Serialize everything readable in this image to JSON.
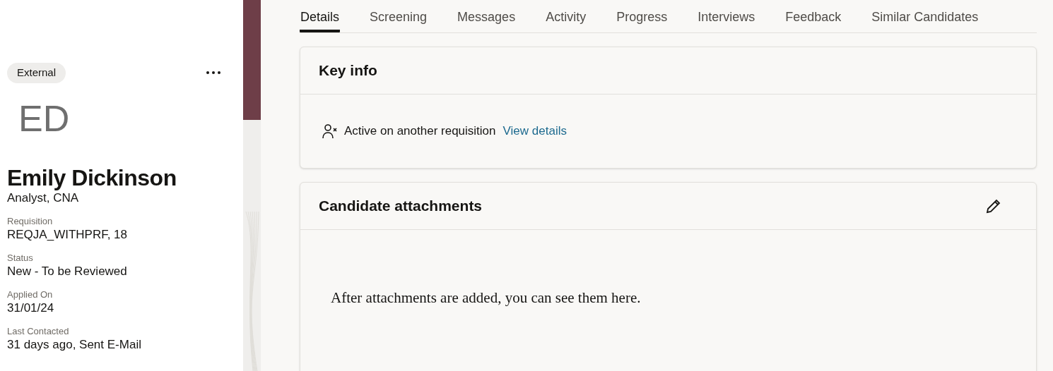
{
  "candidate": {
    "badge": "External",
    "initials": "ED",
    "name": "Emily Dickinson",
    "title": "Analyst, CNA",
    "fields": [
      {
        "label": "Requisition",
        "value": "REQJA_WITHPRF, 18"
      },
      {
        "label": "Status",
        "value": "New - To be Reviewed"
      },
      {
        "label": "Applied On",
        "value": "31/01/24"
      },
      {
        "label": "Last Contacted",
        "value": "31 days ago, Sent E-Mail"
      }
    ]
  },
  "tabs": [
    {
      "label": "Details",
      "selected": true
    },
    {
      "label": "Screening",
      "selected": false
    },
    {
      "label": "Messages",
      "selected": false
    },
    {
      "label": "Activity",
      "selected": false
    },
    {
      "label": "Progress",
      "selected": false
    },
    {
      "label": "Interviews",
      "selected": false
    },
    {
      "label": "Feedback",
      "selected": false
    },
    {
      "label": "Similar Candidates",
      "selected": false
    }
  ],
  "key_info": {
    "title": "Key info",
    "message": "Active on another requisition",
    "link": "View details"
  },
  "attachments": {
    "title": "Candidate attachments",
    "empty_message": "After attachments are added, you can see them here."
  }
}
